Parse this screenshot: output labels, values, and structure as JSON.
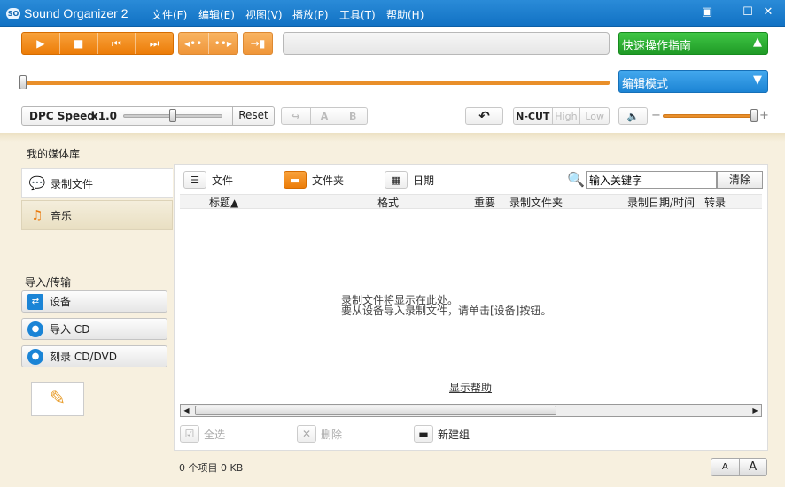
{
  "app": {
    "title": "Sound Organizer 2",
    "logo_text": "SO"
  },
  "menu": [
    "文件(F)",
    "编辑(E)",
    "视图(V)",
    "播放(P)",
    "工具(T)",
    "帮助(H)"
  ],
  "transport": {
    "play": "▶",
    "stop": "■",
    "prev": "⏮",
    "next": "⏭"
  },
  "quick_guide": {
    "label": "快速操作指南",
    "arrow": "▲"
  },
  "edit_mode": {
    "label": "编辑模式",
    "arrow": "▼"
  },
  "playback": {
    "progress_fraction": 0.0
  },
  "speed": {
    "label": "DPC Speed",
    "value": "x1.0",
    "reset": "Reset"
  },
  "ab_buttons": {
    "a": "A",
    "b": "B"
  },
  "ncut": {
    "label": "N-CUT",
    "high": "High",
    "low": "Low"
  },
  "volume": {
    "minus": "−",
    "plus": "+"
  },
  "library": {
    "title": "我的媒体库",
    "tabs": [
      {
        "label": "录制文件"
      },
      {
        "label": "音乐"
      }
    ]
  },
  "import": {
    "title": "导入/传输",
    "buttons": [
      {
        "label": "设备"
      },
      {
        "label": "导入 CD"
      },
      {
        "label": "刻录 CD/DVD"
      }
    ]
  },
  "views": {
    "file": "文件",
    "folder": "文件夹",
    "date": "日期"
  },
  "search": {
    "value": "输入关键字",
    "clear": "清除"
  },
  "columns": {
    "title": "标题▲",
    "format": "格式",
    "important": "重要",
    "folder": "录制文件夹",
    "date": "录制日期/时间",
    "transfer": "转录"
  },
  "empty": {
    "line1": "录制文件将显示在此处。",
    "line2": "要从设备导入录制文件，请单击[设备]按钮。"
  },
  "help_link": "显示帮助",
  "bottom_tools": {
    "select_all": "全选",
    "delete": "删除",
    "new_group": "新建组"
  },
  "status": "0 个项目 0 KB",
  "font_size": {
    "small": "A",
    "large": "A"
  }
}
